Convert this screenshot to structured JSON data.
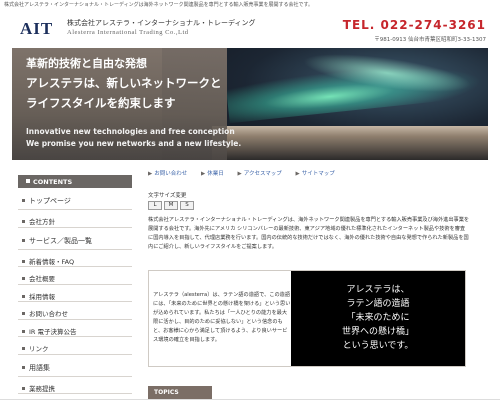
{
  "topbar": {
    "text": "株式会社アレステラ・インターナショナル・トレーディングは海外ネットワーク関連製品を専門とする輸入販売事業を展開する会社です。"
  },
  "header": {
    "logo": "AIT",
    "company_jp": "株式会社アレステラ・インターナショナル・トレーディング",
    "company_en": "Alesterra International Trading Co.,Ltd",
    "tel": "TEL. 022-274-3261",
    "address": "〒981-0913 仙台市青葉区昭和町3-33-1307"
  },
  "hero": {
    "line1": "革新的技術と自由な発想",
    "line2": "アレステラは、新しいネットワークと",
    "line3": "ライフスタイルを約束します",
    "en1": "Innovative new technologies and free conception",
    "en2": "We promise you new networks and a new lifestyle."
  },
  "sidebar": {
    "heading": "CONTENTS",
    "items": [
      {
        "label": "トップページ"
      },
      {
        "label": "会社方針"
      },
      {
        "label": "サービス／製品一覧"
      },
      {
        "label": "新着情報・FAQ"
      },
      {
        "label": "会社概要"
      },
      {
        "label": "採用情報"
      },
      {
        "label": "お問い合わせ"
      },
      {
        "label": "IR 電子決算公告"
      },
      {
        "label": "リンク"
      },
      {
        "label": "用語集"
      },
      {
        "label": "業務提携"
      }
    ]
  },
  "nav": {
    "links": [
      "お問い合わせ",
      "休業日",
      "アクセスマップ",
      "サイトマップ"
    ]
  },
  "font_size": {
    "label": "文字サイズ変更",
    "buttons": [
      "L",
      "M",
      "S"
    ]
  },
  "intro": {
    "text": "株式会社アレステラ・インターナショナル・トレーディングは、海外ネットワーク関連製品を専門とする輸入販売事業及び海外進出事業を展開する会社です。海外先にアメリカ シリコンバレーの最新技術、東アジア地域の優れた標準化されたインターネット製品や技術を審査に国内導入を目指して、代理店業務を行います。国内の伝統的な技術だけではなく、海外の優れた技術や自由な発想で作られた新製品を国内にご紹介し、新しいライフスタイルをご提案します。"
  },
  "feature": {
    "left_text": "アレステラ（alesterra）は、ラテン語の造語で、この造語には、「未来のために世界との懸け橋を架ける」という思いが込められています。私たちは「一人ひとりの能力を最大限に活かし、目的のために妥協しない」という信念のもと、お客様に心から満足して頂けるよう、より良いサービス環境の確立を目指します。",
    "right_lines": [
      "アレステラは、",
      "ラテン語の造語",
      "「未来のために",
      "世界への懸け橋」",
      "という思いです。"
    ]
  },
  "topics": {
    "label": "TOPICS"
  }
}
